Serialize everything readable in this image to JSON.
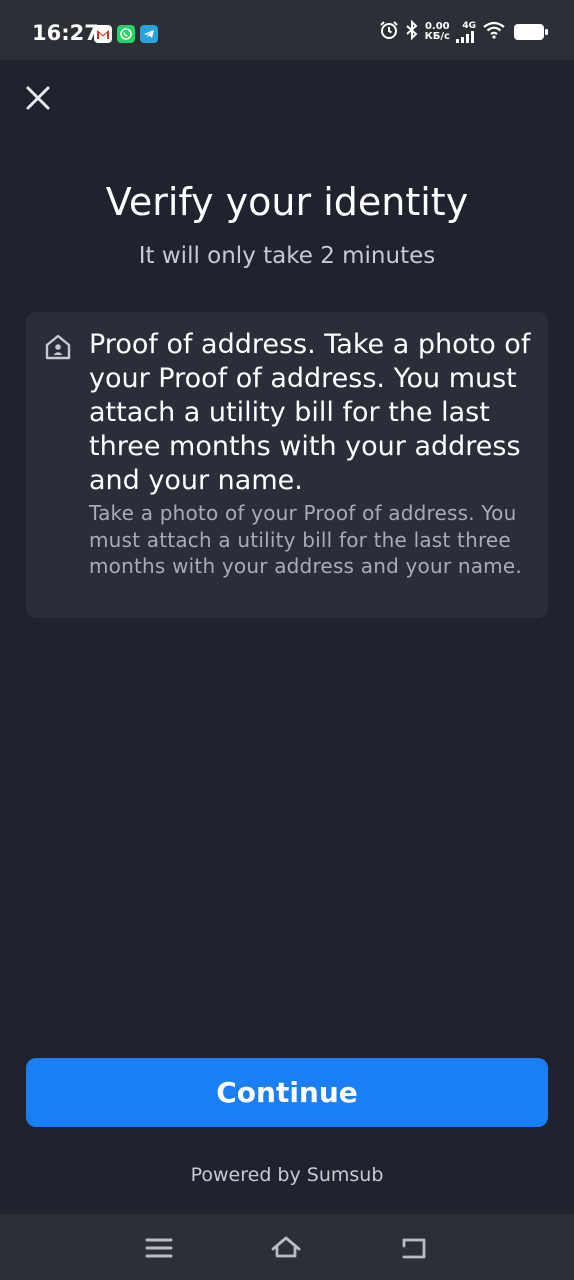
{
  "status_bar": {
    "time": "16:27",
    "notifications": [
      "gmail-icon",
      "whatsapp-icon",
      "telegram-icon"
    ],
    "net_speed_value": "0.00",
    "net_speed_unit": "КБ/с",
    "network_type": "4G"
  },
  "header": {
    "close_icon": "close-icon"
  },
  "main": {
    "title": "Verify your identity",
    "subtitle": "It will only take 2 minutes",
    "card": {
      "icon": "house-icon",
      "heading": "Proof of address. Take a photo of your Proof of address. You must attach a utility bill for the last three months with your address and your name.",
      "description": "Take a photo of your Proof of address. You must attach a utility bill for the last three months with your address and your name."
    }
  },
  "footer": {
    "continue_label": "Continue",
    "powered_by": "Powered by Sumsub"
  },
  "nav_bar": {
    "icons": [
      "menu-icon",
      "home-icon",
      "back-icon"
    ]
  },
  "colors": {
    "background": "#1f232d",
    "card": "#2a2e38",
    "accent": "#1a7ff5",
    "system_bar": "#2c2f36"
  }
}
